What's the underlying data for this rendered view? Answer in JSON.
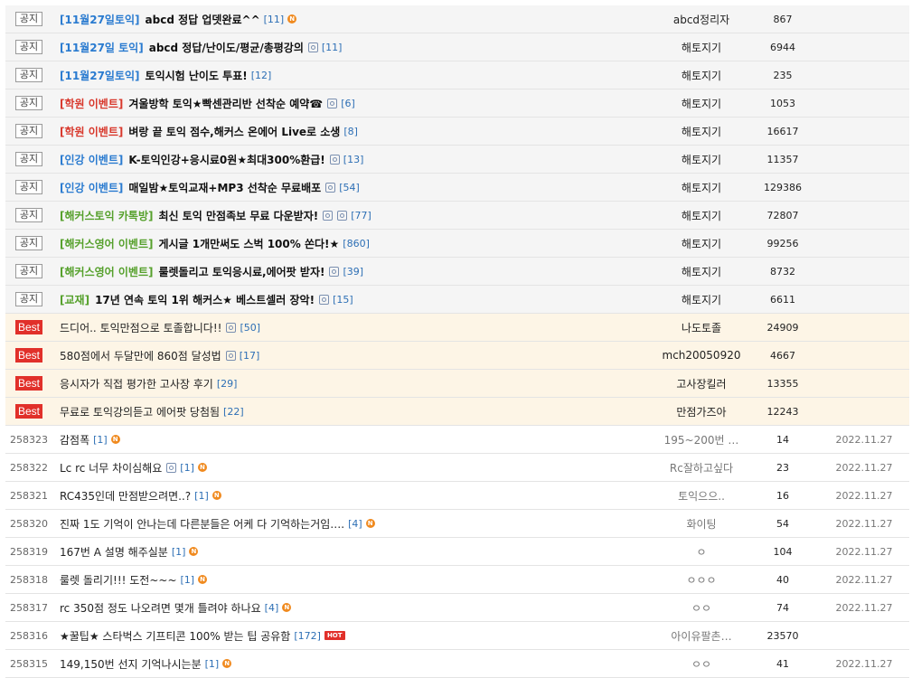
{
  "notices": [
    {
      "badge": "공지",
      "category": "[11월27일토익]",
      "cat_color": "blue",
      "title": "abcd 정답 업뎃완료^^",
      "icons": [],
      "count": "[11]",
      "new": true,
      "author": "abcd정리자",
      "views": "867"
    },
    {
      "badge": "공지",
      "category": "[11월27일 토익]",
      "cat_color": "blue",
      "title": "abcd 정답/난이도/평균/총평강의",
      "icons": [
        "image-icon"
      ],
      "count": "[11]",
      "new": false,
      "author": "해토지기",
      "views": "6944"
    },
    {
      "badge": "공지",
      "category": "[11월27일토익]",
      "cat_color": "blue",
      "title": "토익시험 난이도 투표!",
      "icons": [],
      "count": "[12]",
      "new": false,
      "author": "해토지기",
      "views": "235"
    },
    {
      "badge": "공지",
      "category": "[학원 이벤트]",
      "cat_color": "red",
      "title": "겨울방학 토익★빡센관리반 선착순 예약☎",
      "icons": [
        "image-icon"
      ],
      "count": "[6]",
      "new": false,
      "author": "해토지기",
      "views": "1053"
    },
    {
      "badge": "공지",
      "category": "[학원 이벤트]",
      "cat_color": "red",
      "title": "벼랑 끝 토익 점수,해커스 온에어 Live로 소생",
      "icons": [],
      "count": "[8]",
      "new": false,
      "author": "해토지기",
      "views": "16617"
    },
    {
      "badge": "공지",
      "category": "[인강 이벤트]",
      "cat_color": "blue",
      "title": "K-토익인강+응시료0원★최대300%환급!",
      "icons": [
        "image-icon"
      ],
      "count": "[13]",
      "new": false,
      "author": "해토지기",
      "views": "11357"
    },
    {
      "badge": "공지",
      "category": "[인강 이벤트]",
      "cat_color": "blue",
      "title": "매일밤★토익교재+MP3 선착순 무료배포",
      "icons": [
        "image-icon"
      ],
      "count": "[54]",
      "new": false,
      "author": "해토지기",
      "views": "129386"
    },
    {
      "badge": "공지",
      "category": "[해커스토익 카톡방]",
      "cat_color": "green",
      "title": "최신 토익 만점족보 무료 다운받자!",
      "icons": [
        "image-icon",
        "image-icon"
      ],
      "count": "[77]",
      "new": false,
      "author": "해토지기",
      "views": "72807"
    },
    {
      "badge": "공지",
      "category": "[해커스영어 이벤트]",
      "cat_color": "green",
      "title": "게시글 1개만써도 스벅 100% 쏜다!★",
      "icons": [],
      "count": "[860]",
      "new": false,
      "author": "해토지기",
      "views": "99256"
    },
    {
      "badge": "공지",
      "category": "[해커스영어 이벤트]",
      "cat_color": "green",
      "title": "룰렛돌리고 토익응시료,에어팟 받자!",
      "icons": [
        "image-icon"
      ],
      "count": "[39]",
      "new": false,
      "author": "해토지기",
      "views": "8732"
    },
    {
      "badge": "공지",
      "category": "[교재]",
      "cat_color": "green",
      "title": "17년 연속 토익 1위 해커스★ 베스트셀러 장악!",
      "icons": [
        "image-icon"
      ],
      "count": "[15]",
      "new": false,
      "author": "해토지기",
      "views": "6611"
    }
  ],
  "best": [
    {
      "badge": "Best",
      "title": "드디어.. 토익만점으로 토졸합니다!!",
      "icons": [
        "image-icon"
      ],
      "count": "[50]",
      "author": "나도토졸",
      "views": "24909"
    },
    {
      "badge": "Best",
      "title": "580점에서 두달만에 860점 달성법",
      "icons": [
        "image-icon"
      ],
      "count": "[17]",
      "author": "mch20050920",
      "views": "4667"
    },
    {
      "badge": "Best",
      "title": "응시자가 직접 평가한 고사장 후기",
      "icons": [],
      "count": "[29]",
      "author": "고사장킬러",
      "views": "13355"
    },
    {
      "badge": "Best",
      "title": "무료로 토익강의듣고 에어팟 당첨됨",
      "icons": [],
      "count": "[22]",
      "author": "만점가즈아",
      "views": "12243"
    }
  ],
  "posts": [
    {
      "num": "258323",
      "title": "감점폭",
      "icons": [],
      "count": "[1]",
      "tag": "N",
      "author": "195~200번 …",
      "views": "14",
      "date": "2022.11.27"
    },
    {
      "num": "258322",
      "title": "Lc rc 너무 차이심해요",
      "icons": [
        "image-icon"
      ],
      "count": "[1]",
      "tag": "N",
      "author": "Rc잘하고싶다",
      "views": "23",
      "date": "2022.11.27"
    },
    {
      "num": "258321",
      "title": "RC435인데 만점받으려면..?",
      "icons": [],
      "count": "[1]",
      "tag": "N",
      "author": "토익으으..",
      "views": "16",
      "date": "2022.11.27"
    },
    {
      "num": "258320",
      "title": "진짜 1도 기억이 안나는데 다른분들은 어케 다 기억하는거임….",
      "icons": [],
      "count": "[4]",
      "tag": "N",
      "author": "화이팅",
      "views": "54",
      "date": "2022.11.27"
    },
    {
      "num": "258319",
      "title": "167번 A 설명 해주실분",
      "icons": [],
      "count": "[1]",
      "tag": "N",
      "author": "ㅇ",
      "views": "104",
      "date": "2022.11.27"
    },
    {
      "num": "258318",
      "title": "룰렛 돌리기!!! 도전~~~",
      "icons": [],
      "count": "[1]",
      "tag": "N",
      "author": "ㅇㅇㅇ",
      "views": "40",
      "date": "2022.11.27"
    },
    {
      "num": "258317",
      "title": "rc 350점 정도 나오려면 몇개 틀려야 하나요",
      "icons": [],
      "count": "[4]",
      "tag": "N",
      "author": "ㅇㅇ",
      "views": "74",
      "date": "2022.11.27"
    },
    {
      "num": "258316",
      "title": "★꿀팁★ 스타벅스 기프티콘 100% 받는 팁 공유함",
      "icons": [],
      "count": "[172]",
      "tag": "HOT",
      "author": "아이유팔촌…",
      "views": "23570",
      "date": ""
    },
    {
      "num": "258315",
      "title": "149,150번 선지 기억나시는분",
      "icons": [],
      "count": "[1]",
      "tag": "N",
      "author": "ㅇㅇ",
      "views": "41",
      "date": "2022.11.27"
    }
  ]
}
